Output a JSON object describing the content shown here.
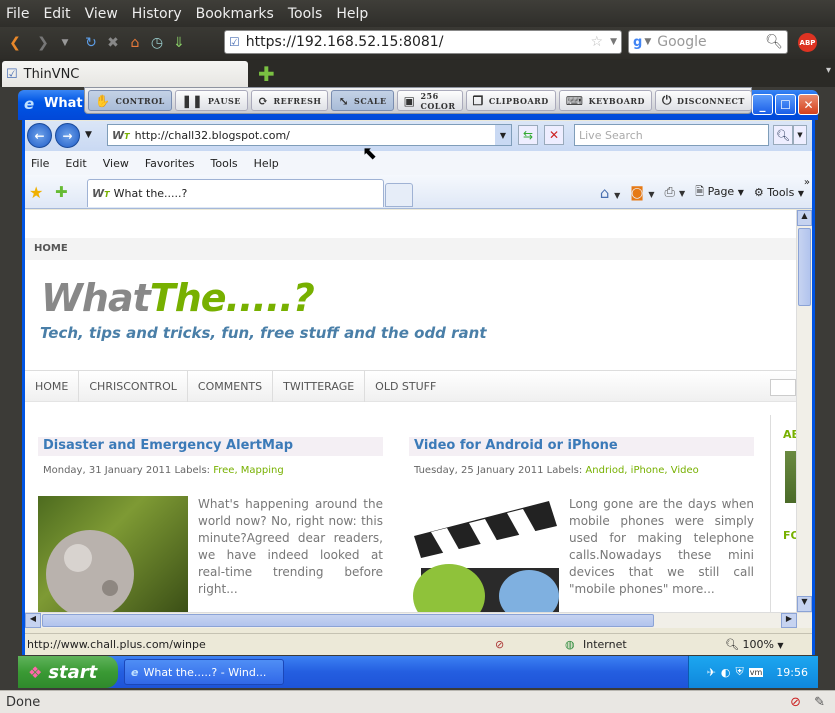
{
  "firefox": {
    "menu": [
      "File",
      "Edit",
      "View",
      "History",
      "Bookmarks",
      "Tools",
      "Help"
    ],
    "url": "https://192.168.52.15:8081/",
    "search_placeholder": "Google",
    "tab_title": "ThinVNC",
    "status": "Done"
  },
  "vnc_toolbar": [
    "CONTROL",
    "PAUSE",
    "REFRESH",
    "SCALE",
    "256 COLOR",
    "CLIPBOARD",
    "KEYBOARD",
    "DISCONNECT"
  ],
  "xp_window": {
    "title": "What"
  },
  "ie": {
    "address": "http://chall32.blogspot.com/",
    "live_search_placeholder": "Live Search",
    "menu": [
      "File",
      "Edit",
      "View",
      "Favorites",
      "Tools",
      "Help"
    ],
    "tab_title": "What the.....?",
    "cmd_page": "Page",
    "cmd_tools": "Tools",
    "status_url": "http://www.chall.plus.com/winpe",
    "zone": "Internet",
    "zoom": "100%"
  },
  "blog": {
    "topbar": "HOME",
    "title_a": "What",
    "title_b": "The.....?",
    "description": "Tech, tips and tricks, fun, free stuff and the odd rant",
    "nav": [
      "HOME",
      "CHRISCONTROL",
      "COMMENTS",
      "TWITTERAGE",
      "OLD STUFF"
    ],
    "posts": [
      {
        "title": "Disaster and Emergency AlertMap",
        "date": "Monday, 31 January 2011",
        "labels_prefix": "Labels:",
        "labels": "Free, Mapping",
        "text": "What's happening around the world now? No, right now: this minute?Agreed dear readers, we have indeed looked at real-time trending before right..."
      },
      {
        "title": "Video for Android or iPhone",
        "date": "Tuesday, 25 January 2011",
        "labels_prefix": "Labels:",
        "labels": "Andriod, iPhone, Video",
        "text": "Long gone are the days when mobile phones were simply used for making telephone calls.Nowadays these mini devices that we still call \"mobile phones\" more..."
      }
    ],
    "sidebar_a": "AB",
    "sidebar_b": "FO"
  },
  "taskbar": {
    "start": "start",
    "task": "What the.....? - Wind...",
    "clock": "19:56"
  }
}
